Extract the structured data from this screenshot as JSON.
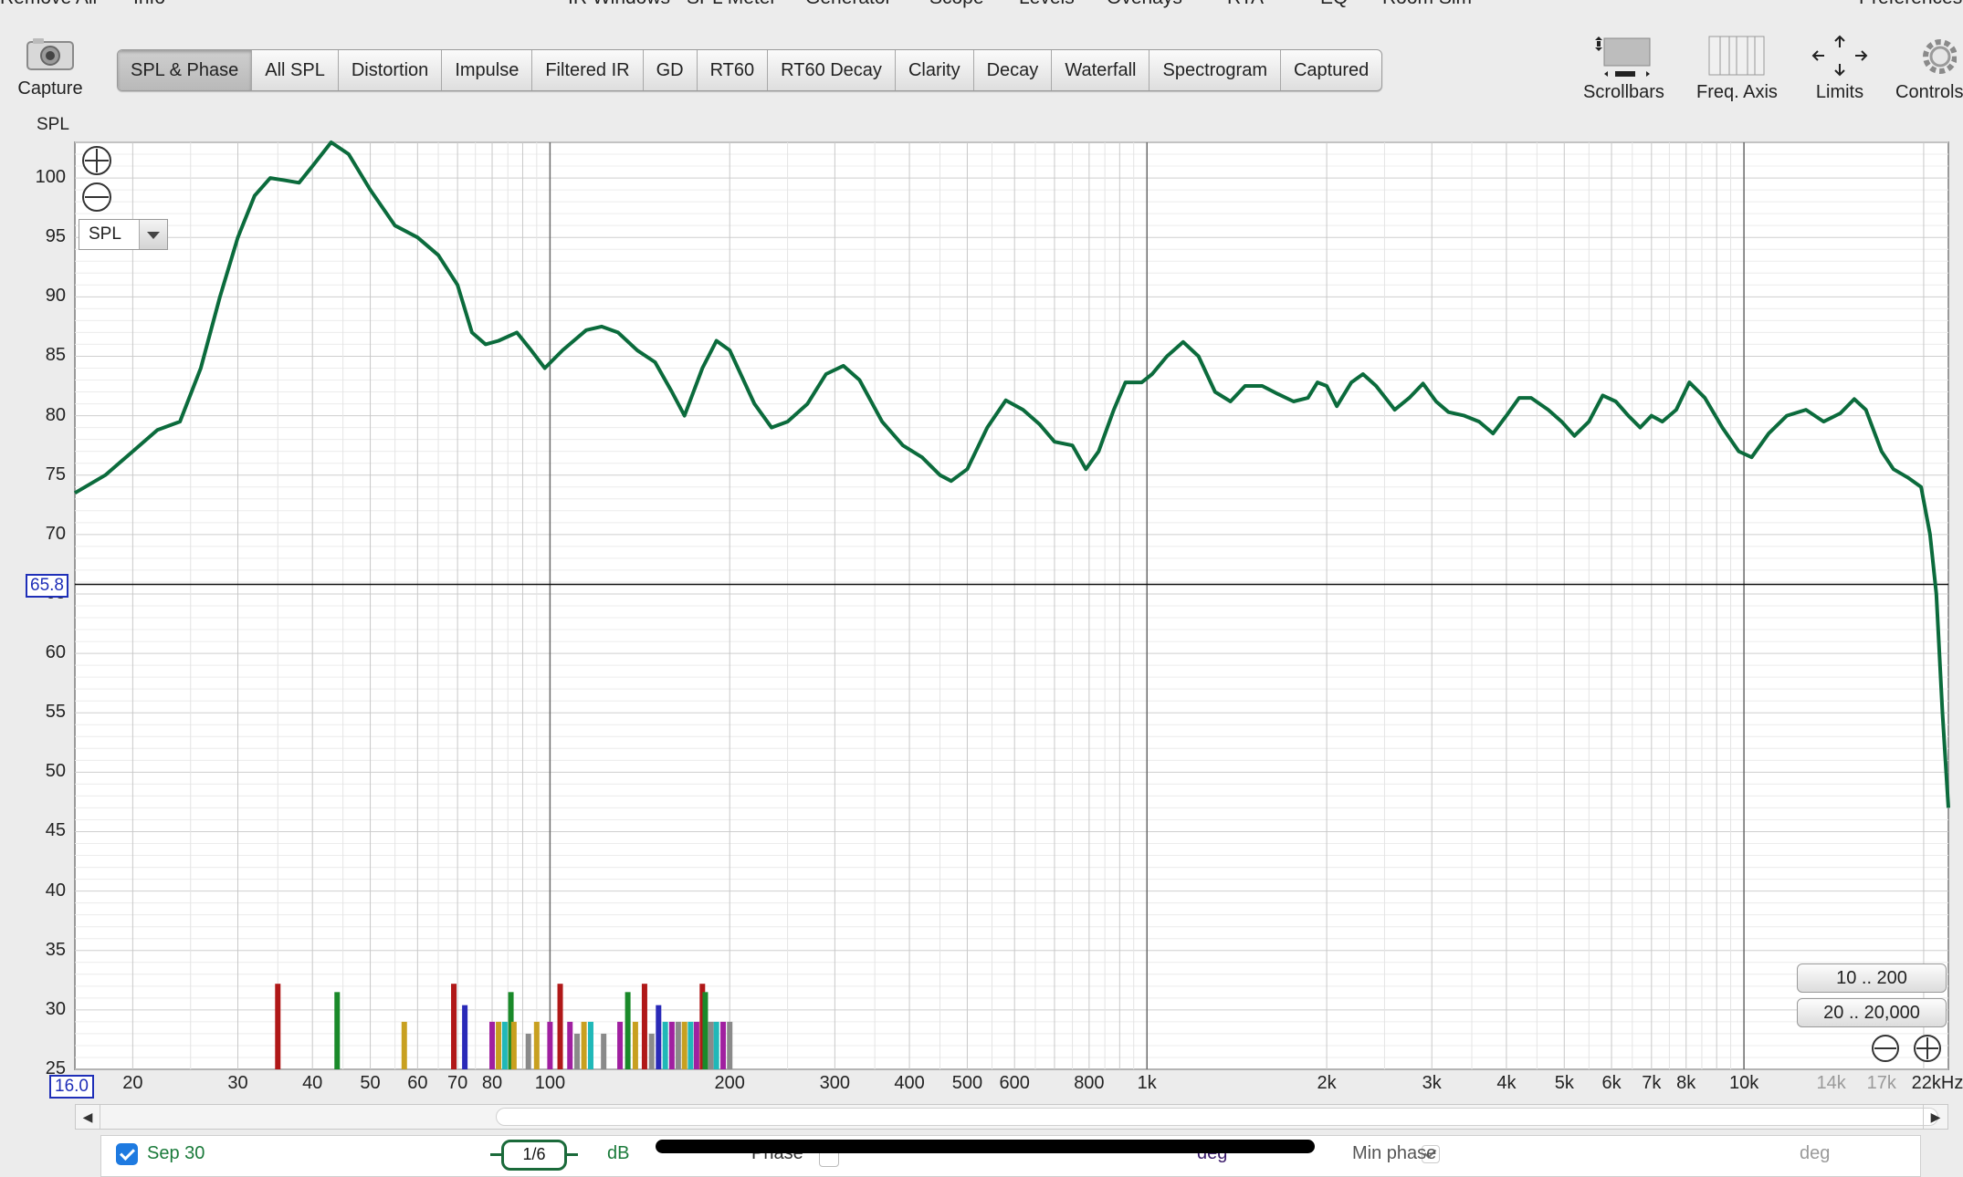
{
  "menu": {
    "items": [
      "Remove All",
      "Info",
      "IR Windows",
      "SPL Meter",
      "Generator",
      "Scope",
      "Levels",
      "Overlays",
      "RTA",
      "EQ",
      "Room Sim",
      "Preferences"
    ]
  },
  "toolbar": {
    "capture_label": "Capture",
    "tabs": [
      "SPL & Phase",
      "All SPL",
      "Distortion",
      "Impulse",
      "Filtered IR",
      "GD",
      "RT60",
      "RT60 Decay",
      "Clarity",
      "Decay",
      "Waterfall",
      "Spectrogram",
      "Captured"
    ],
    "active_tab": "SPL & Phase",
    "tools": {
      "scrollbars": "Scrollbars",
      "freq_axis": "Freq. Axis",
      "limits": "Limits",
      "controls": "Controls"
    }
  },
  "graph": {
    "y_axis_label": "SPL",
    "cursor_value": "65.8",
    "freq_start": "16.0",
    "trace_selector": "SPL",
    "range_buttons": [
      "10 .. 200",
      "20 .. 20,000"
    ],
    "colors": {
      "trace": "#0b6b3c",
      "grid_major": "#8c8c8c",
      "grid_minor": "#d6d6d6",
      "plot_bg": "#ffffff"
    }
  },
  "chart_data": {
    "type": "line",
    "title": "",
    "xlabel": "",
    "ylabel": "SPL",
    "x_scale": "log",
    "xlim": [
      16,
      22000
    ],
    "ylim": [
      25,
      103
    ],
    "y_ticks": [
      100,
      95,
      90,
      85,
      80,
      75,
      70,
      65,
      60,
      55,
      50,
      45,
      40,
      35,
      30,
      25
    ],
    "x_tick_labels": [
      {
        "f": 20,
        "label": "20"
      },
      {
        "f": 30,
        "label": "30"
      },
      {
        "f": 40,
        "label": "40"
      },
      {
        "f": 50,
        "label": "50"
      },
      {
        "f": 60,
        "label": "60"
      },
      {
        "f": 70,
        "label": "70"
      },
      {
        "f": 80,
        "label": "80"
      },
      {
        "f": 100,
        "label": "100"
      },
      {
        "f": 200,
        "label": "200"
      },
      {
        "f": 300,
        "label": "300"
      },
      {
        "f": 400,
        "label": "400"
      },
      {
        "f": 500,
        "label": "500"
      },
      {
        "f": 600,
        "label": "600"
      },
      {
        "f": 800,
        "label": "800"
      },
      {
        "f": 1000,
        "label": "1k"
      },
      {
        "f": 2000,
        "label": "2k"
      },
      {
        "f": 3000,
        "label": "3k"
      },
      {
        "f": 4000,
        "label": "4k"
      },
      {
        "f": 5000,
        "label": "5k"
      },
      {
        "f": 6000,
        "label": "6k"
      },
      {
        "f": 7000,
        "label": "7k"
      },
      {
        "f": 8000,
        "label": "8k"
      },
      {
        "f": 10000,
        "label": "10k"
      },
      {
        "f": 14000,
        "label": "14k"
      },
      {
        "f": 17000,
        "label": "17k"
      },
      {
        "f": 22000,
        "label": "22kHz"
      }
    ],
    "series": [
      {
        "color": "#0b6b3c",
        "points": [
          [
            16,
            73.5
          ],
          [
            18,
            75
          ],
          [
            20,
            77
          ],
          [
            22,
            78.8
          ],
          [
            24,
            79.5
          ],
          [
            26,
            84
          ],
          [
            28,
            90
          ],
          [
            30,
            95
          ],
          [
            32,
            98.5
          ],
          [
            34,
            100
          ],
          [
            36,
            99.8
          ],
          [
            38,
            99.6
          ],
          [
            40,
            101
          ],
          [
            43,
            103
          ],
          [
            46,
            102
          ],
          [
            50,
            99
          ],
          [
            55,
            96
          ],
          [
            60,
            95
          ],
          [
            65,
            93.5
          ],
          [
            70,
            91
          ],
          [
            74,
            87
          ],
          [
            78,
            86
          ],
          [
            82,
            86.3
          ],
          [
            88,
            87
          ],
          [
            93,
            85.5
          ],
          [
            98,
            84
          ],
          [
            105,
            85.5
          ],
          [
            115,
            87.2
          ],
          [
            122,
            87.5
          ],
          [
            130,
            87
          ],
          [
            140,
            85.5
          ],
          [
            150,
            84.5
          ],
          [
            160,
            82
          ],
          [
            168,
            80
          ],
          [
            180,
            84
          ],
          [
            190,
            86.3
          ],
          [
            200,
            85.5
          ],
          [
            220,
            81
          ],
          [
            235,
            79
          ],
          [
            250,
            79.5
          ],
          [
            270,
            81
          ],
          [
            290,
            83.5
          ],
          [
            310,
            84.2
          ],
          [
            330,
            83
          ],
          [
            360,
            79.5
          ],
          [
            390,
            77.5
          ],
          [
            420,
            76.5
          ],
          [
            450,
            75
          ],
          [
            470,
            74.5
          ],
          [
            500,
            75.5
          ],
          [
            540,
            79
          ],
          [
            580,
            81.3
          ],
          [
            620,
            80.5
          ],
          [
            660,
            79.3
          ],
          [
            700,
            77.8
          ],
          [
            750,
            77.5
          ],
          [
            790,
            75.5
          ],
          [
            830,
            77
          ],
          [
            880,
            80.5
          ],
          [
            920,
            82.8
          ],
          [
            980,
            82.8
          ],
          [
            1020,
            83.5
          ],
          [
            1080,
            85
          ],
          [
            1150,
            86.2
          ],
          [
            1220,
            85
          ],
          [
            1300,
            82
          ],
          [
            1380,
            81.2
          ],
          [
            1460,
            82.5
          ],
          [
            1560,
            82.5
          ],
          [
            1660,
            81.8
          ],
          [
            1760,
            81.2
          ],
          [
            1860,
            81.5
          ],
          [
            1930,
            82.8
          ],
          [
            2000,
            82.5
          ],
          [
            2080,
            80.8
          ],
          [
            2200,
            82.8
          ],
          [
            2300,
            83.5
          ],
          [
            2420,
            82.5
          ],
          [
            2600,
            80.5
          ],
          [
            2750,
            81.5
          ],
          [
            2900,
            82.7
          ],
          [
            3050,
            81.2
          ],
          [
            3200,
            80.3
          ],
          [
            3400,
            80
          ],
          [
            3600,
            79.5
          ],
          [
            3800,
            78.5
          ],
          [
            4000,
            80
          ],
          [
            4200,
            81.5
          ],
          [
            4400,
            81.5
          ],
          [
            4700,
            80.5
          ],
          [
            4950,
            79.5
          ],
          [
            5200,
            78.3
          ],
          [
            5500,
            79.5
          ],
          [
            5800,
            81.7
          ],
          [
            6100,
            81.2
          ],
          [
            6400,
            80
          ],
          [
            6700,
            79
          ],
          [
            7000,
            80
          ],
          [
            7300,
            79.5
          ],
          [
            7700,
            80.5
          ],
          [
            8100,
            82.8
          ],
          [
            8600,
            81.5
          ],
          [
            9200,
            79
          ],
          [
            9800,
            77
          ],
          [
            10300,
            76.5
          ],
          [
            11000,
            78.5
          ],
          [
            11800,
            80
          ],
          [
            12700,
            80.5
          ],
          [
            13600,
            79.5
          ],
          [
            14500,
            80.2
          ],
          [
            15300,
            81.4
          ],
          [
            16000,
            80.5
          ],
          [
            17000,
            77
          ],
          [
            17800,
            75.5
          ],
          [
            18800,
            74.8
          ],
          [
            19800,
            74
          ],
          [
            20500,
            70
          ],
          [
            21000,
            65
          ],
          [
            21500,
            55
          ],
          [
            22000,
            47
          ]
        ]
      }
    ],
    "distortion_bars": [
      {
        "f": 35,
        "level": 32.2,
        "color": "#b01818"
      },
      {
        "f": 44,
        "level": 31.5,
        "color": "#1a8a2a"
      },
      {
        "f": 57,
        "level": 29,
        "color": "#c8a020"
      },
      {
        "f": 69,
        "level": 32.2,
        "color": "#b01818"
      },
      {
        "f": 72,
        "level": 30.4,
        "color": "#2a2ab8"
      },
      {
        "f": 80,
        "level": 29,
        "color": "#a020a0"
      },
      {
        "f": 82,
        "level": 29,
        "color": "#c8a020"
      },
      {
        "f": 84,
        "level": 29,
        "color": "#20b8b8"
      },
      {
        "f": 86,
        "level": 31.5,
        "color": "#1a8a2a"
      },
      {
        "f": 87,
        "level": 29,
        "color": "#c8a020"
      },
      {
        "f": 92,
        "level": 28,
        "color": "#8a8a8a"
      },
      {
        "f": 95,
        "level": 29,
        "color": "#c8a020"
      },
      {
        "f": 100,
        "level": 29,
        "color": "#a020a0"
      },
      {
        "f": 104,
        "level": 32.2,
        "color": "#b01818"
      },
      {
        "f": 108,
        "level": 29,
        "color": "#a020a0"
      },
      {
        "f": 111,
        "level": 28,
        "color": "#8a8a8a"
      },
      {
        "f": 114,
        "level": 29,
        "color": "#c8a020"
      },
      {
        "f": 117,
        "level": 29,
        "color": "#20b8b8"
      },
      {
        "f": 123,
        "level": 28,
        "color": "#8a8a8a"
      },
      {
        "f": 131,
        "level": 29,
        "color": "#a020a0"
      },
      {
        "f": 135,
        "level": 31.5,
        "color": "#1a8a2a"
      },
      {
        "f": 139,
        "level": 29,
        "color": "#c8a020"
      },
      {
        "f": 144,
        "level": 32.2,
        "color": "#b01818"
      },
      {
        "f": 148,
        "level": 28,
        "color": "#8a8a8a"
      },
      {
        "f": 152,
        "level": 30.4,
        "color": "#2a2ab8"
      },
      {
        "f": 156,
        "level": 29,
        "color": "#20b8b8"
      },
      {
        "f": 160,
        "level": 29,
        "color": "#a020a0"
      },
      {
        "f": 164,
        "level": 29,
        "color": "#8a8a8a"
      },
      {
        "f": 168,
        "level": 29,
        "color": "#c8a020"
      },
      {
        "f": 172,
        "level": 29,
        "color": "#20b8b8"
      },
      {
        "f": 176,
        "level": 29,
        "color": "#a020a0"
      },
      {
        "f": 180,
        "level": 32.2,
        "color": "#b01818"
      },
      {
        "f": 182,
        "level": 31.5,
        "color": "#1a8a2a"
      },
      {
        "f": 186,
        "level": 29,
        "color": "#8a8a8a"
      },
      {
        "f": 190,
        "level": 29,
        "color": "#20b8b8"
      },
      {
        "f": 195,
        "level": 29,
        "color": "#a020a0"
      },
      {
        "f": 200,
        "level": 29,
        "color": "#8a8a8a"
      }
    ],
    "cursor_level": 65.8
  },
  "legend": {
    "measurement_name": "Sep 30",
    "smoothing": "1/6",
    "spl_unit": "dB",
    "phase_label": "Phase",
    "phase_unit": "deg",
    "min_phase_label": "Min phase",
    "min_phase_unit": "deg"
  }
}
